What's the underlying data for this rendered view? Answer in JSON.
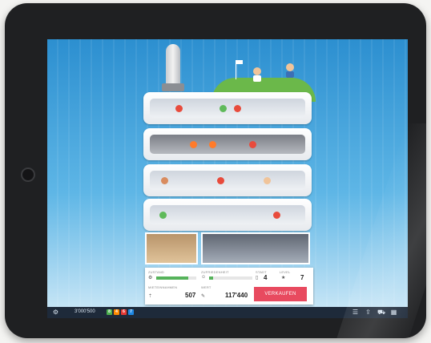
{
  "stats": {
    "zustand_label": "ZUSTAND",
    "zufriedenheit_label": "ZUFRIEDENHEIT",
    "stadt_label": "STADT",
    "level_label": "LEVEL",
    "stadt_value": "4",
    "level_value": "7",
    "mietvermieter_label": "MIETEINNAHMEN",
    "mietvermieter_value": "507",
    "wert_label": "WERT",
    "wert_value": "117'440",
    "zustand_level": 0.8,
    "zufriedenheit_level": 0.1
  },
  "sell_button": "VERKAUFEN",
  "toolbar": {
    "money": "3'000'500",
    "badges": [
      "8",
      "4",
      "6",
      "7"
    ],
    "badge_colors": [
      "#4caf50",
      "#ff8a00",
      "#e53935",
      "#1e88e5"
    ]
  }
}
